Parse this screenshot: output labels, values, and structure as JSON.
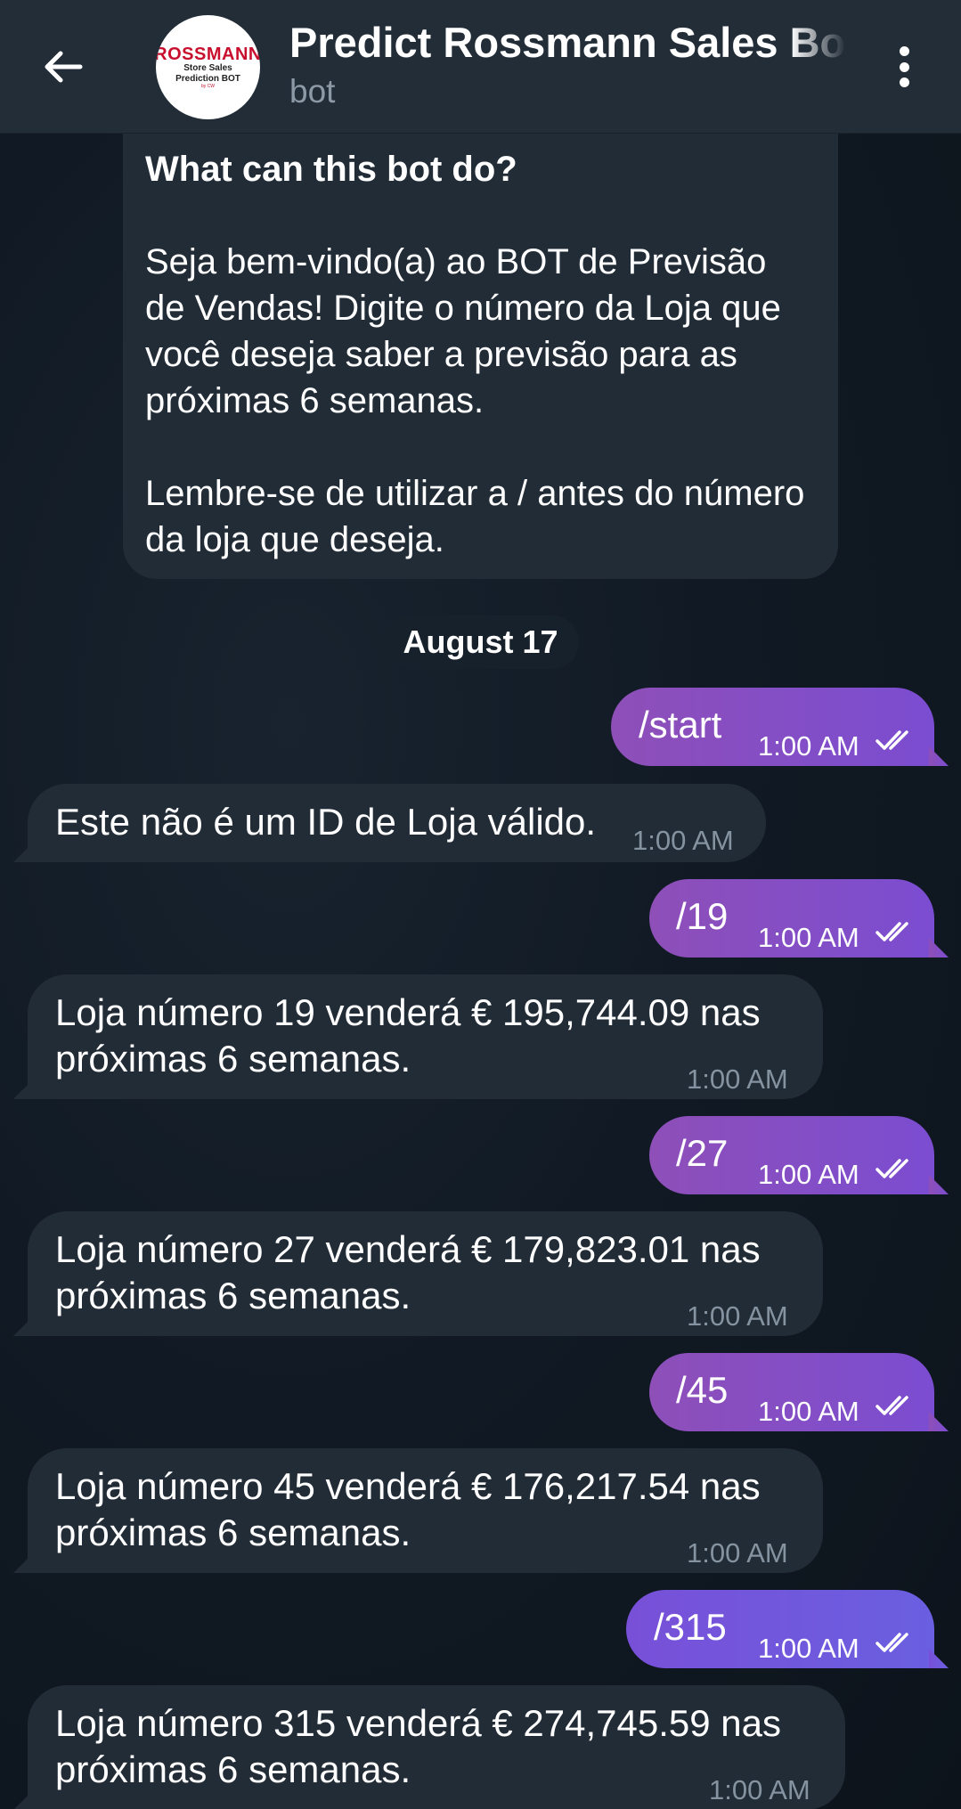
{
  "header": {
    "title": "Predict Rossmann Sales Bot",
    "subtitle": "bot",
    "avatar": {
      "brand": "ROSSMANN",
      "line1": "Store Sales",
      "line2": "Prediction BOT",
      "line3": "by CW"
    },
    "back_icon": "arrow-left-icon",
    "menu_icon": "more-vertical-icon"
  },
  "bot_info": {
    "heading": "What can this bot do?",
    "paragraph1": "Seja bem-vindo(a) ao BOT de Previsão de Vendas! Digite o número da Loja que você deseja saber a previsão para as próximas 6 semanas.",
    "paragraph2": "Lembre-se de utilizar a / antes do número da loja que deseja."
  },
  "date_label": "August 17",
  "messages": [
    {
      "dir": "out",
      "text": "/start",
      "time": "1:00 AM"
    },
    {
      "dir": "in",
      "text": "Este não é um ID de Loja válido.",
      "time": "1:00 AM"
    },
    {
      "dir": "out",
      "text": "/19",
      "time": "1:00 AM"
    },
    {
      "dir": "in",
      "line1": "Loja número 19 venderá € 195,744.09 nas",
      "line2": "próximas 6 semanas.",
      "time": "1:00 AM"
    },
    {
      "dir": "out",
      "text": "/27",
      "time": "1:00 AM"
    },
    {
      "dir": "in",
      "line1": "Loja número 27 venderá € 179,823.01 nas",
      "line2": "próximas 6 semanas.",
      "time": "1:00 AM"
    },
    {
      "dir": "out",
      "text": "/45",
      "time": "1:00 AM"
    },
    {
      "dir": "in",
      "line1": "Loja número 45 venderá € 176,217.54 nas",
      "line2": "próximas 6 semanas.",
      "time": "1:00 AM"
    },
    {
      "dir": "out",
      "text": "/315",
      "time": "1:00 AM"
    },
    {
      "dir": "in",
      "line1": "Loja número 315 venderá € 274,745.59 nas",
      "line2": "próximas 6 semanas.",
      "time": "1:00 AM"
    }
  ],
  "colors": {
    "header_bg": "#222d38",
    "incoming_bubble": "#222c37",
    "outgoing_bubble_start": "#8e4fb8",
    "outgoing_bubble_end": "#7b4dd1",
    "meta_text": "#8593a0"
  }
}
